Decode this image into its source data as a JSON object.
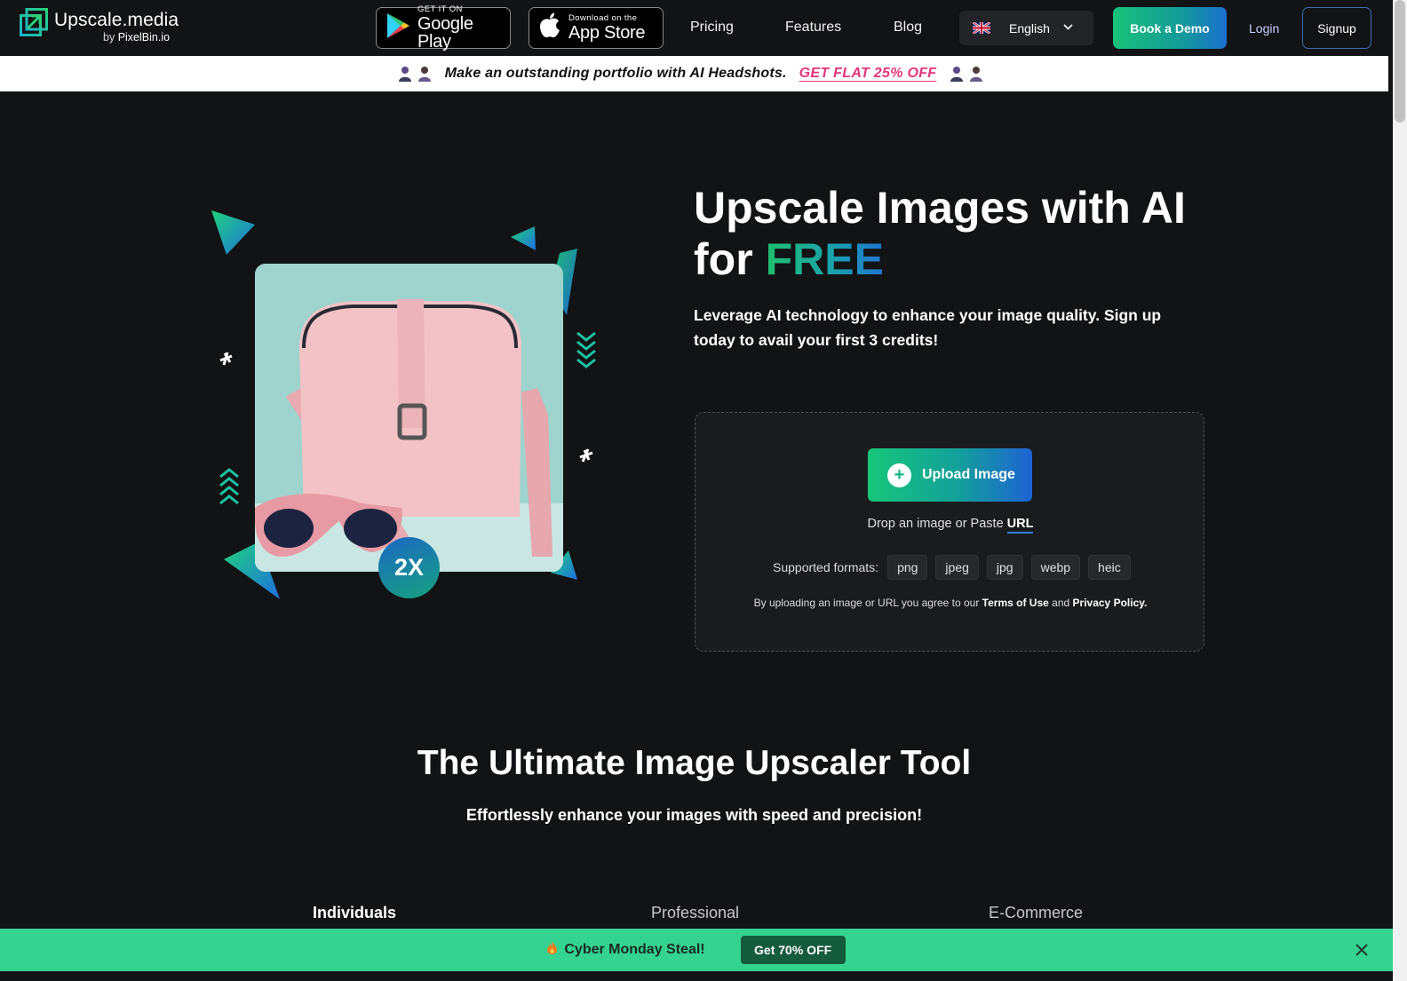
{
  "header": {
    "logo_name": "Upscale.media",
    "logo_by_prefix": "by",
    "logo_by_brand": "PixelBin.io",
    "google_play_small": "GET IT ON",
    "google_play_big": "Google Play",
    "app_store_small": "Download on the",
    "app_store_big": "App Store",
    "nav": [
      "Pricing",
      "Features",
      "Blog"
    ],
    "language": "English",
    "demo_label": "Book a Demo",
    "login_label": "Login",
    "signup_label": "Signup"
  },
  "promo": {
    "text": "Make an outstanding portfolio with AI Headshots.",
    "link": "GET FLAT 25% OFF"
  },
  "hero": {
    "title_line1": "Upscale Images with AI",
    "title_for": "for",
    "title_free": "FREE",
    "subtitle": "Leverage AI technology to enhance your image quality. Sign up today to avail your first 3 credits!",
    "badge": "2X"
  },
  "upload": {
    "button_label": "Upload Image",
    "drop_text": "Drop an image or Paste",
    "url_label": "URL",
    "formats_label": "Supported formats:",
    "formats": [
      "png",
      "jpeg",
      "jpg",
      "webp",
      "heic"
    ],
    "terms_prefix": "By uploading an image or URL you agree to our",
    "terms_link": "Terms of Use",
    "terms_and": "and",
    "privacy_link": "Privacy Policy."
  },
  "section": {
    "title": "The Ultimate Image Upscaler Tool",
    "subtitle": "Effortlessly enhance your images with speed and precision!",
    "tabs": [
      "Individuals",
      "Professional",
      "E-Commerce"
    ],
    "active_tab": "Individuals"
  },
  "bottom_bar": {
    "text": "Cyber Monday Steal!",
    "cta": "Get 70% OFF"
  },
  "colors": {
    "background": "#121315",
    "accent_green": "#16c67a",
    "accent_blue": "#1d63d3",
    "promo_pink": "#e3347e",
    "bottom_bar": "#34d391"
  },
  "icons": [
    "upscale-logo-icon",
    "google-play-icon",
    "apple-icon",
    "uk-flag-icon",
    "chevron-down-icon",
    "person-icon",
    "plus-icon",
    "fire-icon",
    "close-icon"
  ]
}
